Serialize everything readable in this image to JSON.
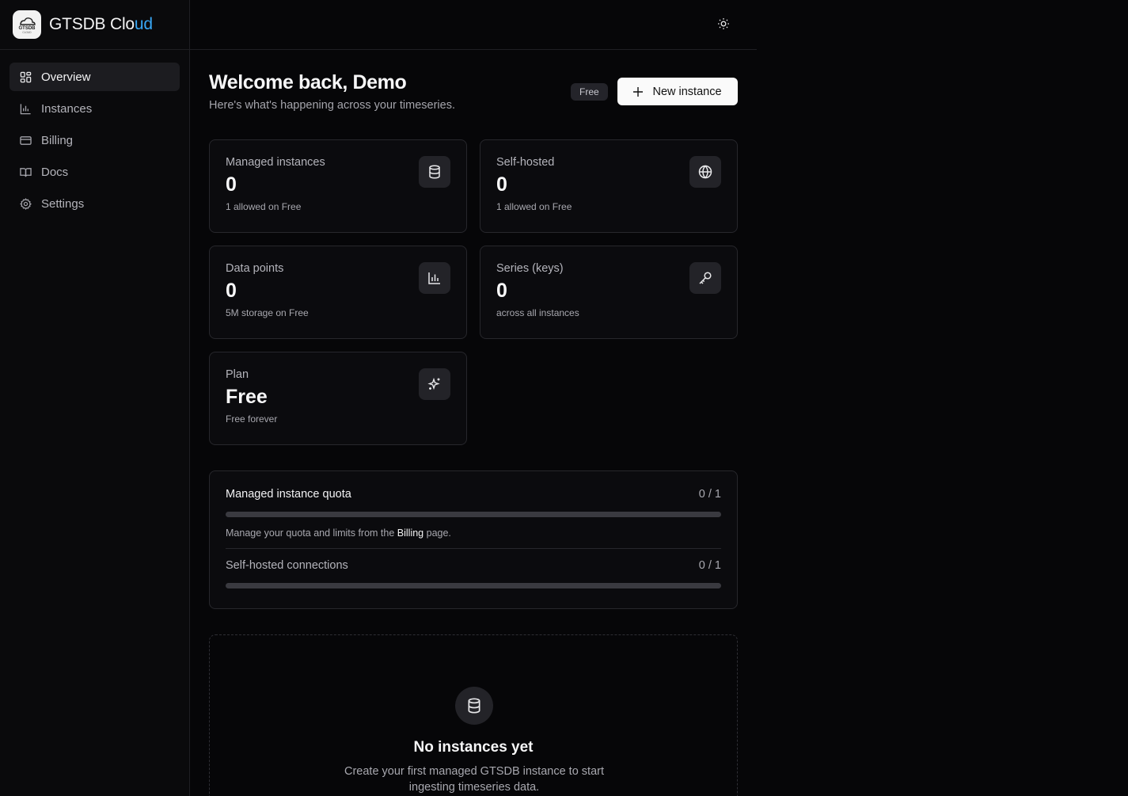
{
  "brand": {
    "name_main": "GTSDB Clo",
    "name_accent": "ud",
    "logo_text": "GTSDB",
    "logo_sub": "CLOUD"
  },
  "sidebar": {
    "items": [
      {
        "label": "Overview",
        "icon": "layout-dashboard-icon",
        "active": true
      },
      {
        "label": "Instances",
        "icon": "bar-chart-icon"
      },
      {
        "label": "Billing",
        "icon": "credit-card-icon"
      },
      {
        "label": "Docs",
        "icon": "book-open-icon"
      },
      {
        "label": "Settings",
        "icon": "gear-icon"
      }
    ]
  },
  "topbar": {
    "theme_icon": "sun-icon"
  },
  "header": {
    "title": "Welcome back, Demo",
    "subtitle": "Here's what's happening across your timeseries.",
    "plan_badge": "Free",
    "new_button": "New instance"
  },
  "cards": [
    {
      "label": "Managed instances",
      "value": "0",
      "note": "1 allowed on Free",
      "icon": "database-icon"
    },
    {
      "label": "Self-hosted",
      "value": "0",
      "note": "1 allowed on Free",
      "icon": "globe-icon"
    },
    {
      "label": "Data points",
      "value": "0",
      "note": "5M storage on Free",
      "icon": "bar-chart-icon"
    },
    {
      "label": "Series (keys)",
      "value": "0",
      "note": "across all instances",
      "icon": "key-icon"
    },
    {
      "label": "Plan",
      "value": "Free",
      "note": "Free forever",
      "icon": "sparkles-icon"
    }
  ],
  "quota": {
    "managed": {
      "title": "Managed instance quota",
      "count": "0 / 1",
      "progress": 0
    },
    "hint_prefix": "Manage your quota and limits from the ",
    "hint_link": "Billing",
    "hint_suffix": " page.",
    "selfhosted": {
      "title": "Self-hosted connections",
      "count": "0 / 1",
      "progress": 0
    }
  },
  "empty": {
    "title": "No instances yet",
    "description": "Create your first managed GTSDB instance to start ingesting timeseries data."
  },
  "colors": {
    "accent": "#38a7f5",
    "background": "#060608",
    "card": "#0b0b0e",
    "border": "#27272c"
  }
}
